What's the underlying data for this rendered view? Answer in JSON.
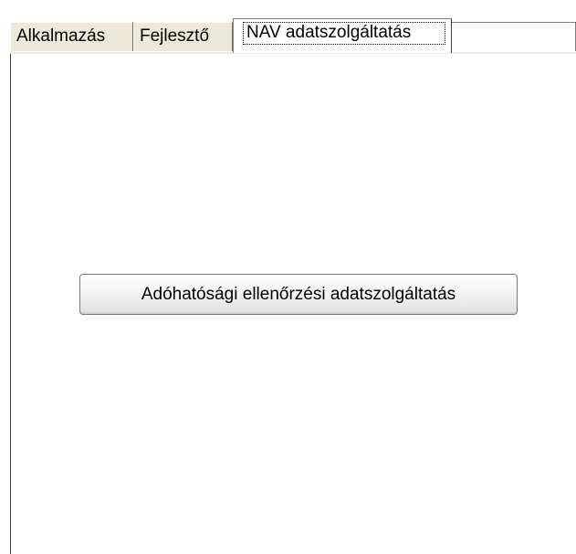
{
  "tabs": [
    {
      "label": "Alkalmazás"
    },
    {
      "label": "Fejlesztő"
    },
    {
      "label": "NAV adatszolgáltatás",
      "active": true
    }
  ],
  "main": {
    "button_label": "Adóhatósági ellenőrzési adatszolgáltatás"
  },
  "colors": {
    "tab_inactive_bg": "#ece9d8",
    "border_dark": "#404040",
    "border_mid": "#808080"
  }
}
